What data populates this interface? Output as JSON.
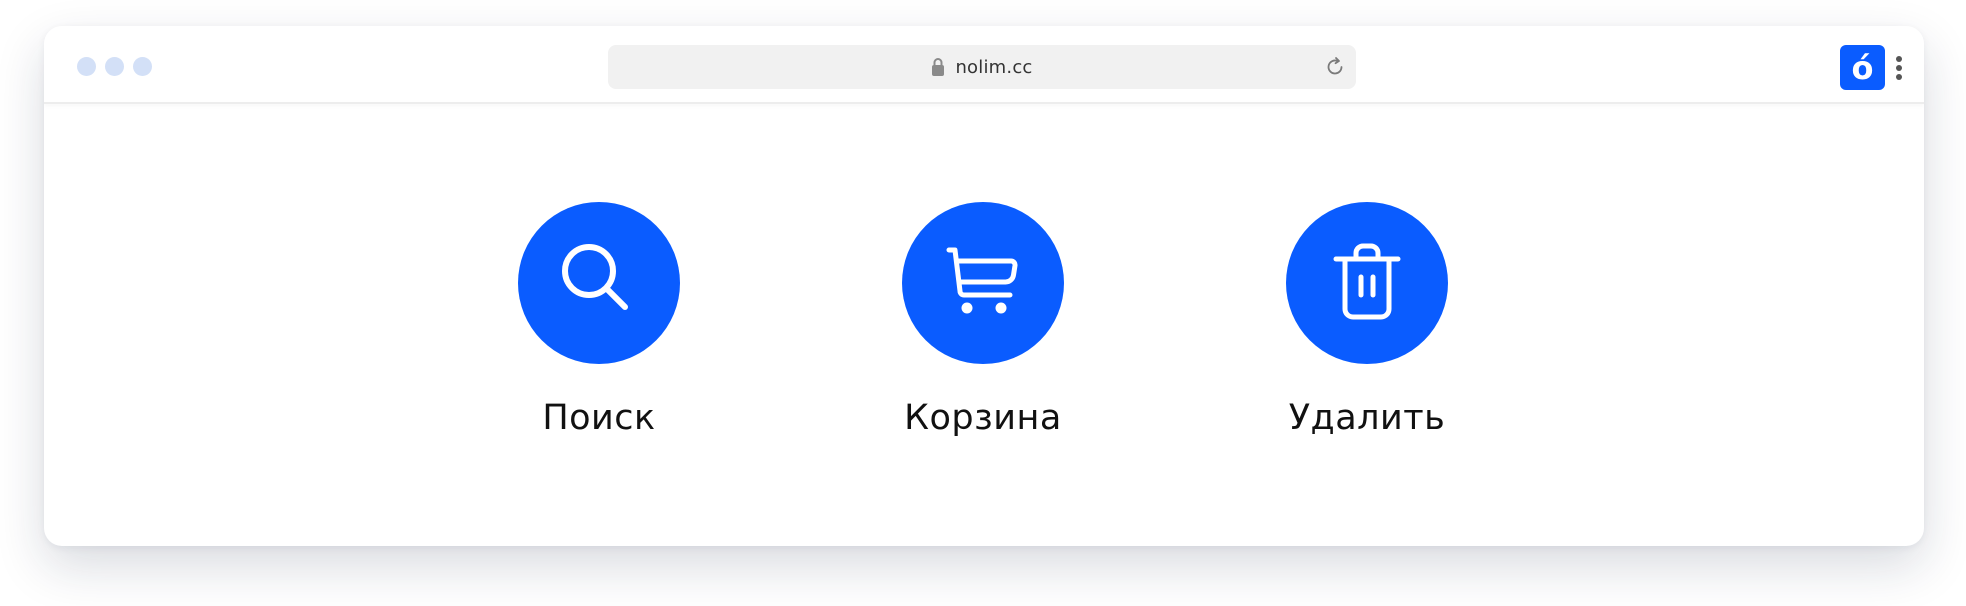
{
  "browser": {
    "url": "nolim.cc",
    "extension_letter": "ó",
    "window_dot_color": "#d3e0f7",
    "accent_color": "#0a5cff",
    "icons": {
      "lock": "lock-icon",
      "reload": "reload-icon",
      "menu": "kebab-menu-icon"
    }
  },
  "features": [
    {
      "label": "Поиск",
      "icon": "search-icon"
    },
    {
      "label": "Корзина",
      "icon": "cart-icon"
    },
    {
      "label": "Удалить",
      "icon": "trash-icon"
    }
  ]
}
